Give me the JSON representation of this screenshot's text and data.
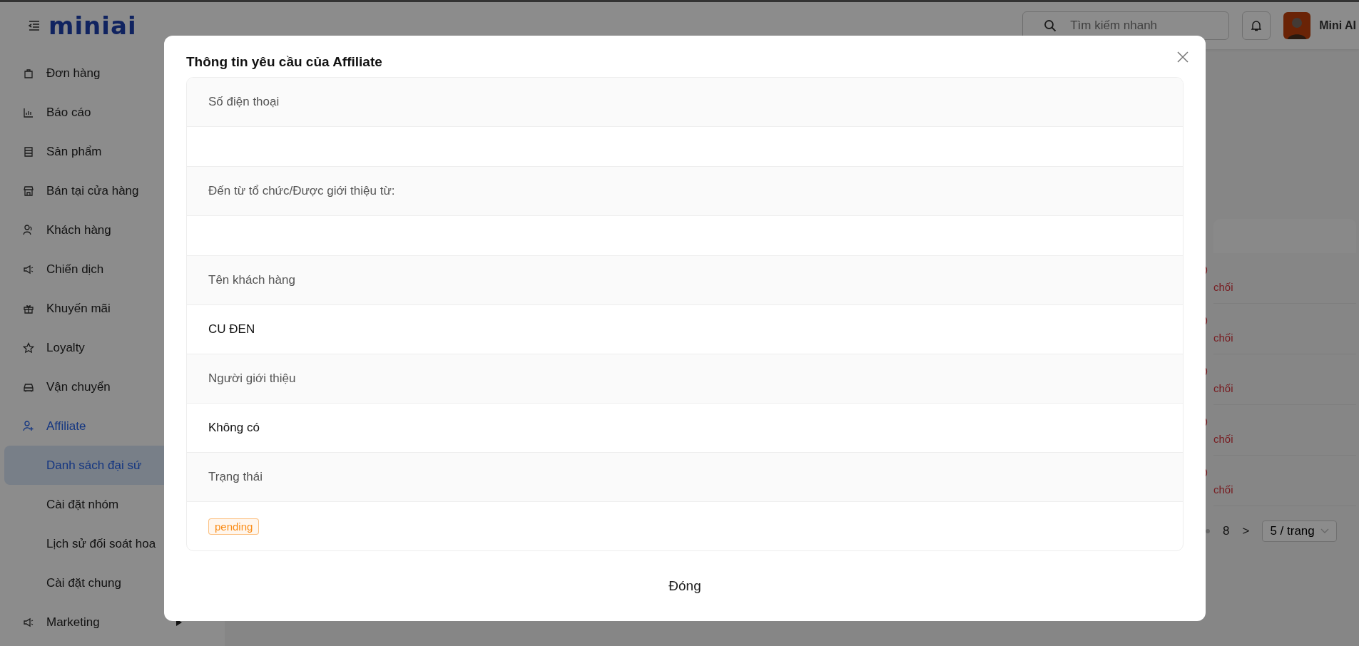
{
  "header": {
    "logo": "miniai",
    "search": {
      "placeholder": "Tìm kiếm nhanh"
    },
    "user_name": "Mini AI"
  },
  "sidebar": {
    "items": [
      {
        "label": "Đơn hàng",
        "selected": false
      },
      {
        "label": "Báo cáo",
        "selected": false
      },
      {
        "label": "Sản phẩm",
        "selected": false
      },
      {
        "label": "Bán tại cửa hàng",
        "selected": false
      },
      {
        "label": "Khách hàng",
        "selected": false
      },
      {
        "label": "Chiến dịch",
        "selected": false
      },
      {
        "label": "Khuyến mãi",
        "selected": false
      },
      {
        "label": "Loyalty",
        "selected": false
      },
      {
        "label": "Vận chuyển",
        "selected": false
      },
      {
        "label": "Affiliate",
        "selected": false,
        "expanded": true,
        "children": [
          {
            "label": "Danh sách đại sứ",
            "selected": true
          },
          {
            "label": "Cài đặt nhóm",
            "selected": false
          },
          {
            "label": "Lịch sử đối soát hoa",
            "selected": false
          },
          {
            "label": "Cài đặt chung",
            "selected": false
          }
        ]
      },
      {
        "label": "Marketing",
        "selected": false,
        "expanded": false
      }
    ]
  },
  "background_table": {
    "rows": [
      {
        "status": "chối"
      },
      {
        "status": "chối"
      },
      {
        "status": "chối"
      },
      {
        "status": "chối"
      },
      {
        "status": "chối"
      }
    ],
    "pagination": {
      "last_page": "8",
      "next": ">",
      "page_size": "5 / trang"
    }
  },
  "dialog": {
    "title": "Thông tin yêu cầu của Affiliate",
    "fields": [
      {
        "label": "Số điện thoại"
      },
      {
        "label": "Đến từ tổ chức/Được giới thiệu từ:"
      },
      {
        "label": "Tên khách hàng",
        "kind": "text",
        "value": "CU ĐEN"
      },
      {
        "label": "Người giới thiệu",
        "kind": "text",
        "value": "Không có"
      },
      {
        "label": "Trạng thái",
        "kind": "tag",
        "value": "pending",
        "color": "#fa8c16"
      }
    ],
    "close_button": "Đóng"
  }
}
